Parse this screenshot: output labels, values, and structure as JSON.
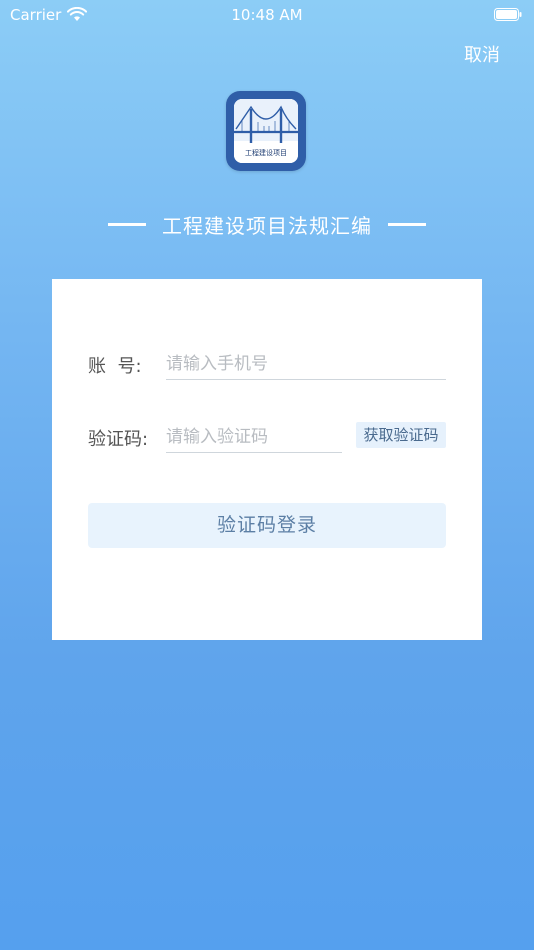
{
  "status_bar": {
    "carrier": "Carrier",
    "time": "10:48 AM"
  },
  "header": {
    "cancel_label": "取消"
  },
  "logo": {
    "caption": "工程建设项目"
  },
  "title": "工程建设项目法规汇编",
  "form": {
    "account_label": "账  号:",
    "account_placeholder": "请输入手机号",
    "code_label": "验证码:",
    "code_placeholder": "请输入验证码",
    "get_code_label": "获取验证码",
    "login_label": "验证码登录"
  },
  "colors": {
    "background_top": "#8ccdf6",
    "background_bottom": "#55a0ee",
    "logo_blue": "#2f5ea8",
    "button_bg": "#e8f3fd"
  }
}
